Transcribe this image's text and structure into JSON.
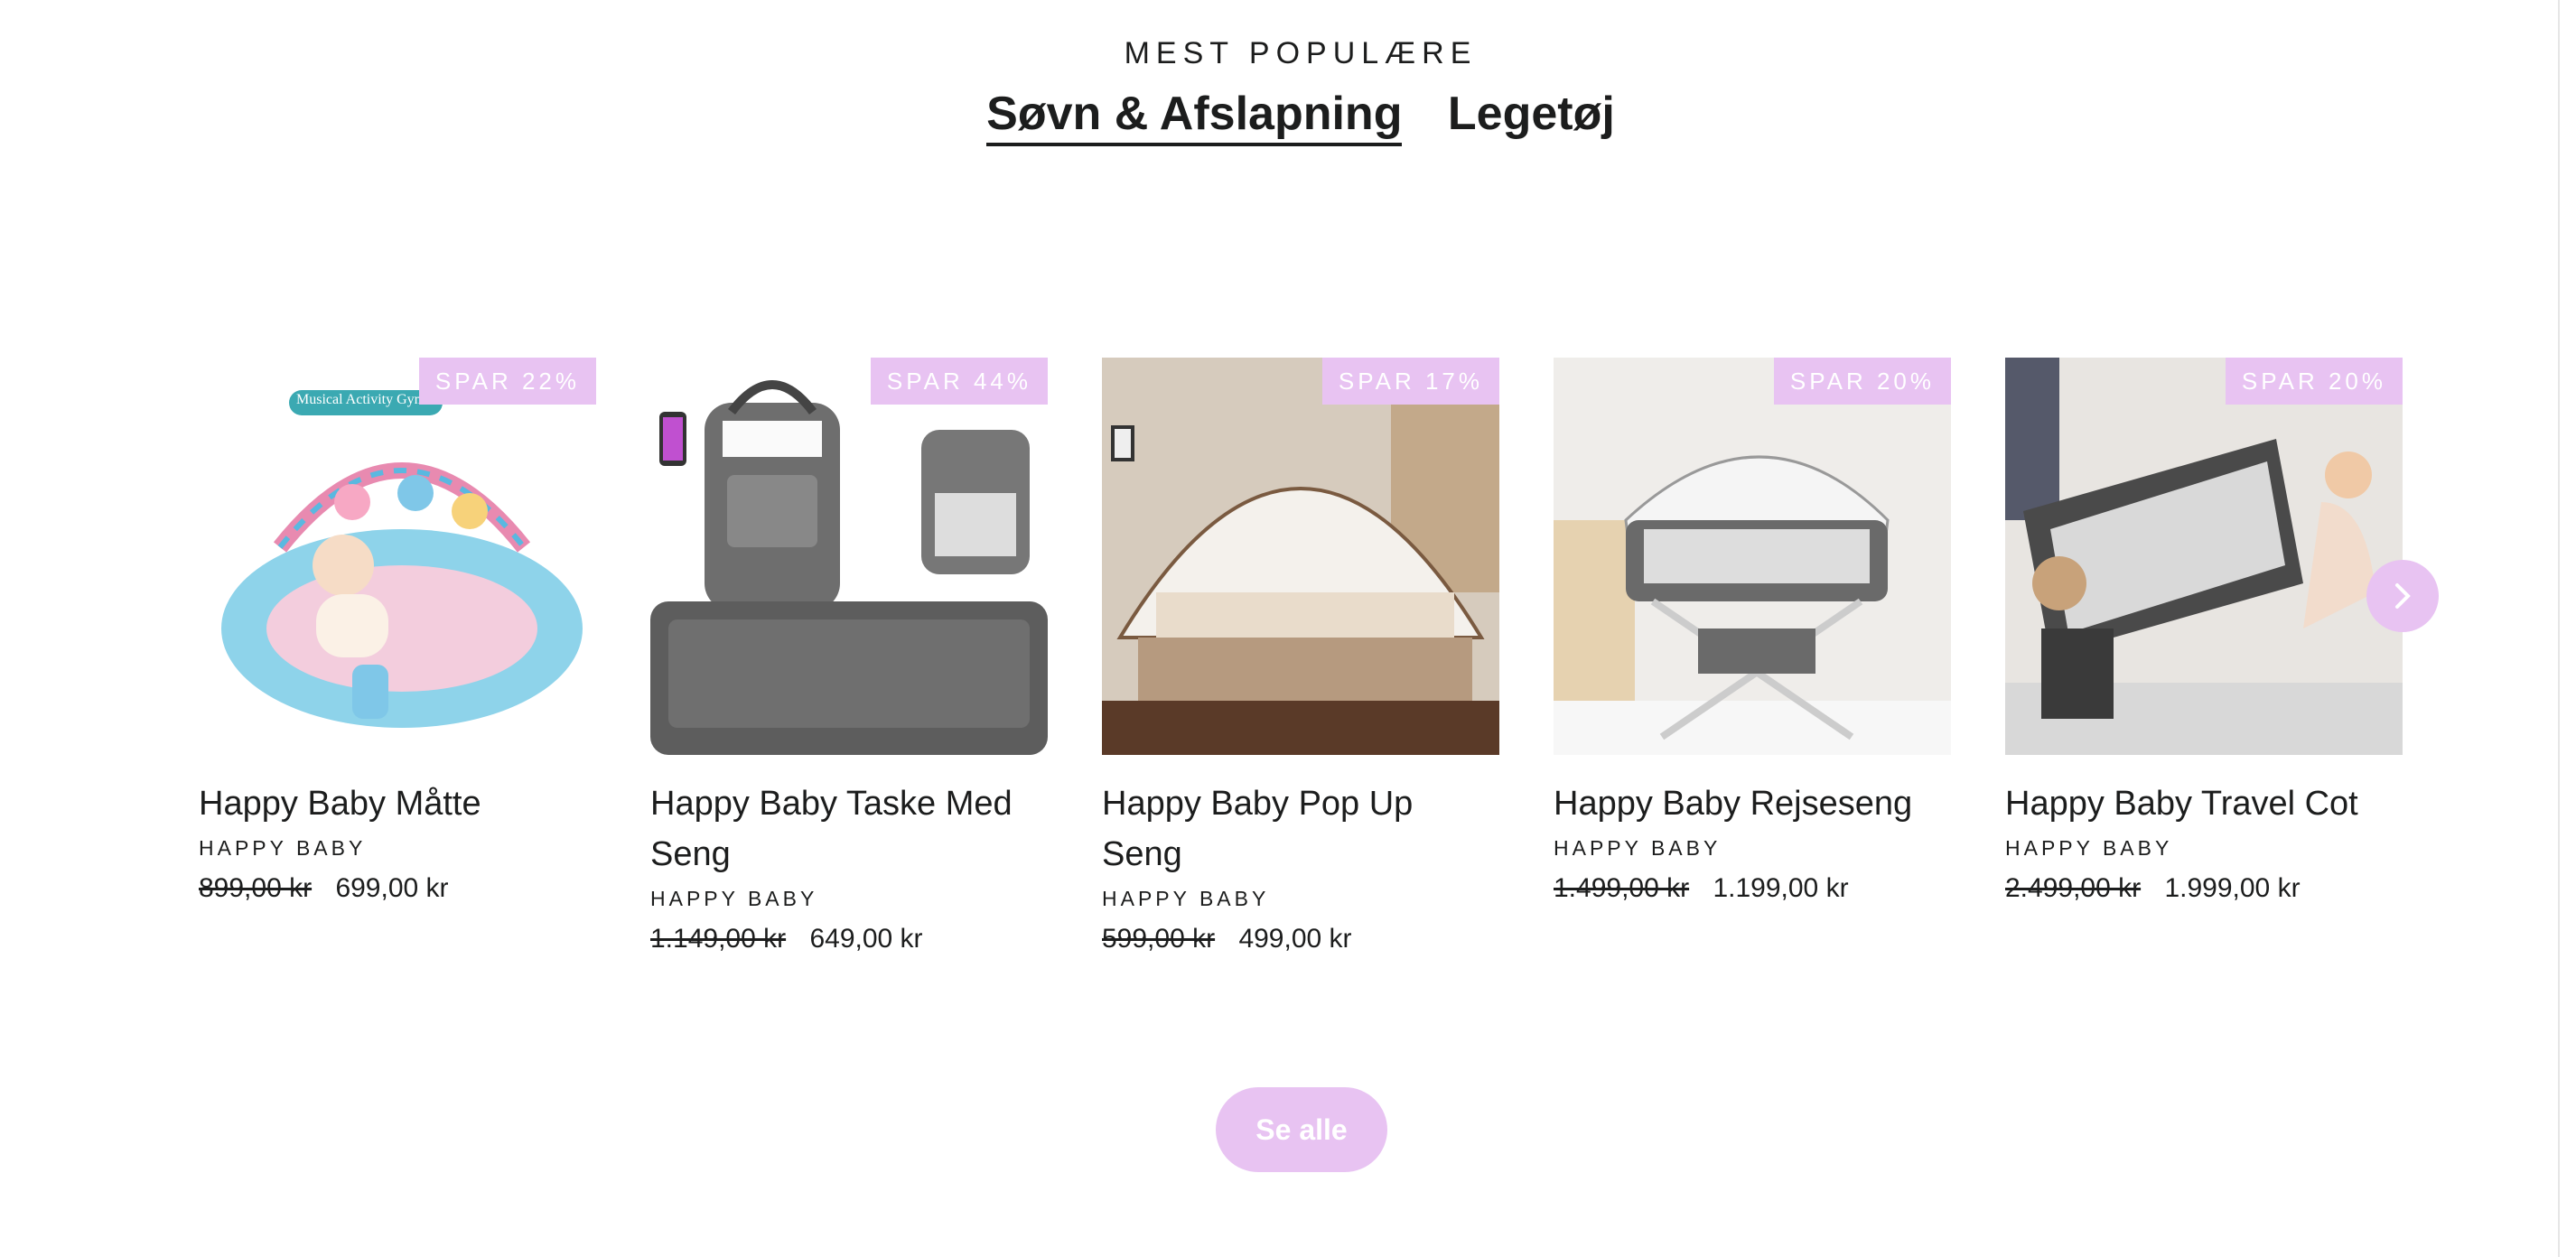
{
  "section": {
    "eyebrow": "MEST POPULÆRE",
    "tabs": [
      {
        "label": "Søvn & Afslapning"
      },
      {
        "label": "Legetøj"
      }
    ]
  },
  "products": [
    {
      "title": "Happy Baby Måtte",
      "brand": "HAPPY BABY",
      "old_price": "899,00 kr",
      "price": "699,00 kr",
      "badge": "SPAR 22%",
      "image_caption": "Musical Activity Gym"
    },
    {
      "title": "Happy Baby Taske Med Seng",
      "brand": "HAPPY BABY",
      "old_price": "1.149,00 kr",
      "price": "649,00 kr",
      "badge": "SPAR 44%"
    },
    {
      "title": "Happy Baby Pop Up Seng",
      "brand": "HAPPY BABY",
      "old_price": "599,00 kr",
      "price": "499,00 kr",
      "badge": "SPAR 17%"
    },
    {
      "title": "Happy Baby Rejseseng",
      "brand": "HAPPY BABY",
      "old_price": "1.499,00 kr",
      "price": "1.199,00 kr",
      "badge": "SPAR 20%"
    },
    {
      "title": "Happy Baby Travel Cot",
      "brand": "HAPPY BABY",
      "old_price": "2.499,00 kr",
      "price": "1.999,00 kr",
      "badge": "SPAR 20%"
    }
  ],
  "carousel": {
    "next_icon": "chevron-right-icon"
  },
  "see_all_label": "Se alle",
  "colors": {
    "accent": "#e8c3f2",
    "text": "#1c1d1d"
  }
}
